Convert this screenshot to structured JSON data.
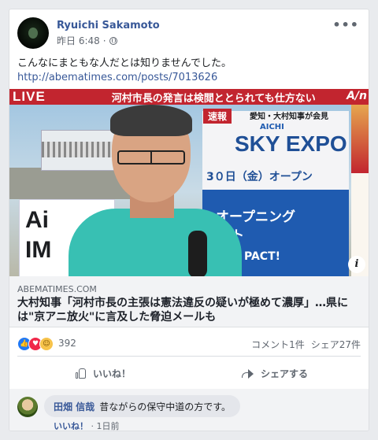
{
  "post": {
    "author": "Ryuichi Sakamoto",
    "time": "昨日 6:48",
    "meta_sep": "·",
    "more_label": "•••",
    "text": "こんなにまともな人だとは知りませんでした。",
    "url": "http://abematimes.com/posts/7013626"
  },
  "media": {
    "live_label": "LIVE",
    "band_text": "河村市長の発言は検閲ととられても仕方ない",
    "band_brand": "A/n",
    "red_tag": "速報",
    "subtitle": "愛知・大村知事が会見",
    "expo_small": "AICHI",
    "expo": "SKY EXPO",
    "date": "3０日（金）オープン",
    "opening": "オープニング",
    "event": "ント",
    "impact": "PACT!",
    "left_ad_1": "Ai",
    "left_ad_2": "IM",
    "info_icon": "i"
  },
  "link_preview": {
    "domain": "ABEMATIMES.COM",
    "title": "大村知事「河村市長の主張は憲法違反の疑いが極めて濃厚」…県には\"京アニ放火\"に言及した脅迫メールも"
  },
  "stats": {
    "reaction_count": "392",
    "comments": "コメント1件",
    "shares": "シェア27件"
  },
  "actions": {
    "like": "いいね！",
    "share": "シェアする"
  },
  "comment": {
    "name": "田畑 信哉",
    "text": "昔ながらの保守中道の方です。",
    "like": "いいね！",
    "sep": "·",
    "time": "1日前"
  },
  "colors": {
    "link": "#385898",
    "live_band": "#c2252f",
    "like_blue": "#2078f4",
    "love_red": "#f0284a",
    "haha_yellow": "#f7c34b"
  }
}
